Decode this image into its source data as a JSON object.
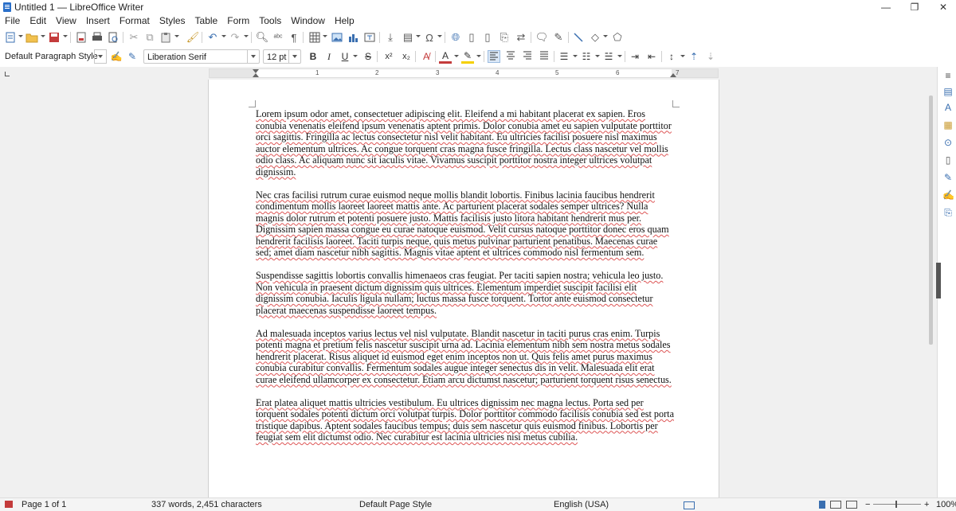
{
  "window": {
    "title": "Untitled 1 — LibreOffice Writer",
    "controls": [
      "—",
      "❐",
      "✕"
    ]
  },
  "menu": [
    "File",
    "Edit",
    "View",
    "Insert",
    "Format",
    "Styles",
    "Table",
    "Form",
    "Tools",
    "Window",
    "Help"
  ],
  "formatting": {
    "paragraph_style": "Default Paragraph Style",
    "font_name": "Liberation Serif",
    "font_size": "12 pt",
    "bold": "B",
    "italic": "I",
    "underline": "U",
    "strike": "S",
    "superscript": "x²",
    "subscript": "x₂"
  },
  "ruler_numbers": [
    "1",
    "2",
    "3",
    "4",
    "5",
    "6",
    "7"
  ],
  "document": {
    "paragraphs": [
      "Lorem ipsum odor amet, consectetuer adipiscing elit. Eleifend a mi habitant placerat ex sapien. Eros conubia venenatis eleifend ipsum venenatis aptent primis. Dolor conubia amet eu sapien vulputate porttitor orci sagittis. Fringilla ac lectus consectetur nisl velit habitant. Eu ultricies facilisi posuere nisl maximus auctor elementum ultrices. Ac congue torquent cras magna fusce fringilla. Lectus class nascetur vel mollis odio class. Ac aliquam nunc sit iaculis vitae. Vivamus suscipit porttitor nostra integer ultrices volutpat dignissim.",
      "Nec cras facilisi rutrum curae euismod neque mollis blandit lobortis. Finibus lacinia faucibus hendrerit condimentum mollis laoreet laoreet mattis ante. Ac parturient placerat sodales semper ultrices? Nulla magnis dolor rutrum et potenti posuere justo. Mattis facilisis justo litora habitant hendrerit mus per. Dignissim sapien massa congue eu curae natoque euismod. Velit cursus natoque porttitor donec eros quam hendrerit facilisis laoreet. Taciti turpis neque, quis metus pulvinar parturient penatibus. Maecenas curae sed; amet diam nascetur nibh sagittis. Magnis vitae aptent et ultrices commodo nisl fermentum sem.",
      "Suspendisse sagittis lobortis convallis himenaeos cras feugiat. Per taciti sapien nostra; vehicula leo justo. Non vehicula in praesent dictum dignissim quis ultrices. Elementum imperdiet suscipit facilisi elit dignissim conubia. Iaculis ligula nullam; luctus massa fusce torquent. Tortor ante euismod consectetur placerat maecenas suspendisse laoreet tempus.",
      "Ad malesuada inceptos varius lectus vel nisl vulputate. Blandit nascetur in taciti purus cras enim. Turpis potenti magna et pretium felis nascetur suscipit urna ad. Lacinia elementum nibh sem nostra metus sodales hendrerit placerat. Risus aliquet id euismod eget enim inceptos non ut. Quis felis amet purus maximus conubia curabitur convallis. Fermentum sodales augue integer senectus dis in velit. Malesuada elit erat curae eleifend ullamcorper ex consectetur. Etiam arcu dictumst nascetur; parturient torquent risus senectus.",
      "Erat platea aliquet mattis ultricies vestibulum. Eu ultrices dignissim nec magna lectus. Porta sed per torquent sodales potenti dictum orci volutpat turpis. Dolor porttitor commodo facilisis conubia sed est porta tristique dapibus. Aptent sodales faucibus tempus; duis sem nascetur quis euismod finibus. Lobortis per feugiat sem elit dictumst odio. Nec curabitur est lacinia ultricies nisi metus cubilia."
    ]
  },
  "status": {
    "page": "Page 1 of 1",
    "words": "337 words, 2,451 characters",
    "page_style": "Default Page Style",
    "language": "English (USA)",
    "zoom": "100%"
  }
}
